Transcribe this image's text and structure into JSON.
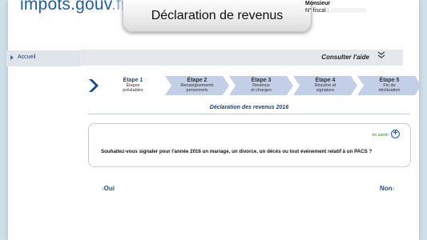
{
  "header": {
    "logo_main": "impots.gouv",
    "logo_tld": ".fr",
    "page_title": "Déclaration de revenus",
    "user_name": "Monsieur",
    "fiscal_label": "N° fiscal :"
  },
  "nav": {
    "home_label": "Accueil"
  },
  "help": {
    "label": "Consulter l'aide"
  },
  "steps": [
    {
      "title": "Étape 1",
      "subtitle_1": "Étapes",
      "subtitle_2": "préalables",
      "status": "active"
    },
    {
      "title": "Étape 2",
      "subtitle_1": "Renseignements",
      "subtitle_2": "personnels",
      "status": "todo"
    },
    {
      "title": "Étape 3",
      "subtitle_1": "Revenus",
      "subtitle_2": "et charges",
      "status": "todo"
    },
    {
      "title": "Étape 4",
      "subtitle_1": "Résumé et",
      "subtitle_2": "signature",
      "status": "todo"
    },
    {
      "title": "Étape 5",
      "subtitle_1": "Fin de",
      "subtitle_2": "déclaration",
      "status": "todo"
    }
  ],
  "section_title": "Déclaration des revenus 2016",
  "question": {
    "more_info_label": "en savoir",
    "text": "Souhaitez-vous signaler pour l'année 2016 un mariage, un divorce, un décès ou tout événement relatif à un PACS ?"
  },
  "choices": {
    "yes_label": "Oui",
    "no_label": "Non",
    "yes_arrow": "‹",
    "no_arrow": "›"
  },
  "colors": {
    "accent": "#1c4a8c",
    "step_fill": "#c3cfe6",
    "background": "#cfe0ea"
  }
}
